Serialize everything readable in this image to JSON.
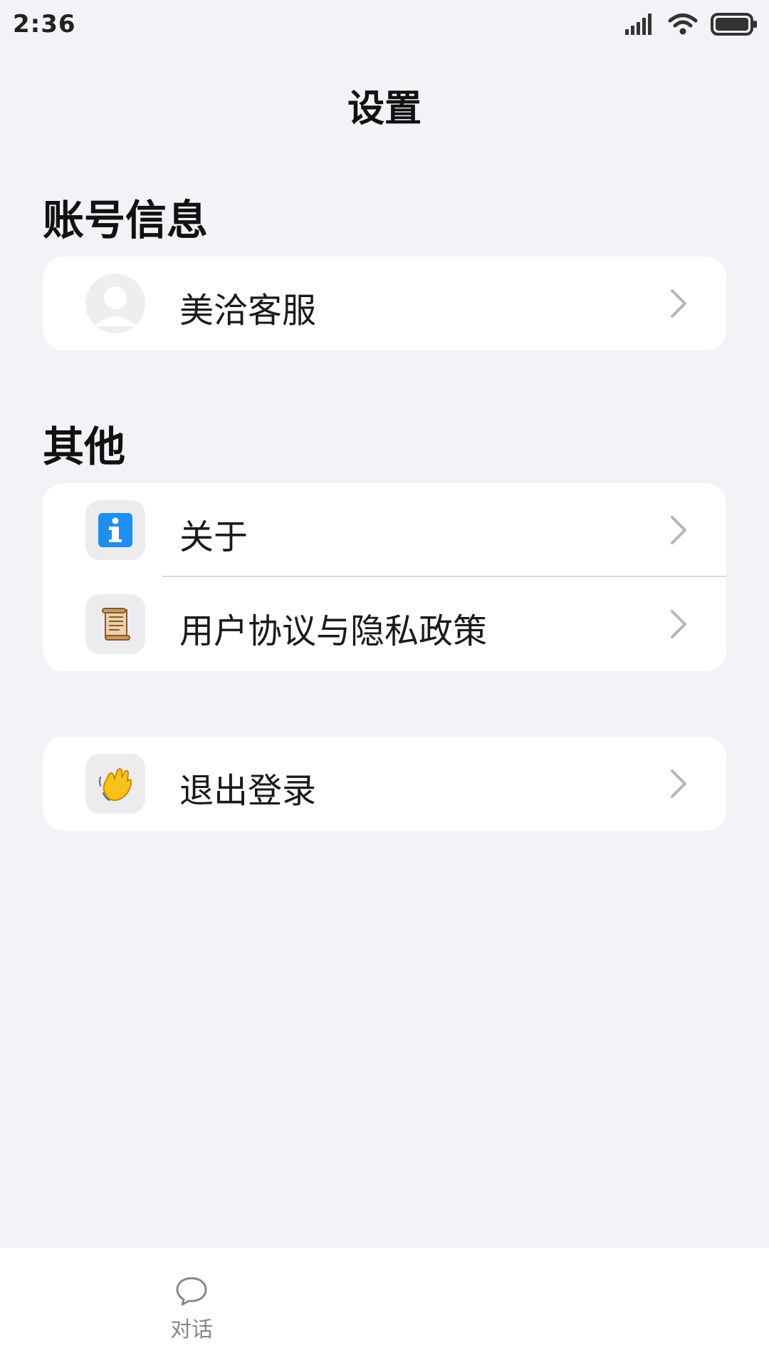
{
  "status_bar": {
    "time": "2:36",
    "icons": [
      "signal-icon",
      "wifi-icon",
      "battery-icon"
    ]
  },
  "header": {
    "title": "设置"
  },
  "sections": {
    "account": {
      "heading": "账号信息",
      "rows": [
        {
          "label": "美洽客服",
          "icon": "avatar-icon"
        }
      ]
    },
    "other": {
      "heading": "其他",
      "rows": [
        {
          "label": "关于",
          "icon": "info-icon"
        },
        {
          "label": "用户协议与隐私政策",
          "icon": "scroll-icon"
        }
      ]
    },
    "logout": {
      "rows": [
        {
          "label": "退出登录",
          "icon": "waving-hand-icon"
        }
      ]
    }
  },
  "bottom_nav": {
    "tabs": [
      {
        "label": "对话",
        "icon": "chat-bubble-icon"
      }
    ]
  },
  "colors": {
    "background": "#f2f2f7",
    "card": "#ffffff",
    "chevron": "#b5b5ba",
    "tab_inactive": "#888888",
    "info_blue": "#1e8ef0"
  }
}
